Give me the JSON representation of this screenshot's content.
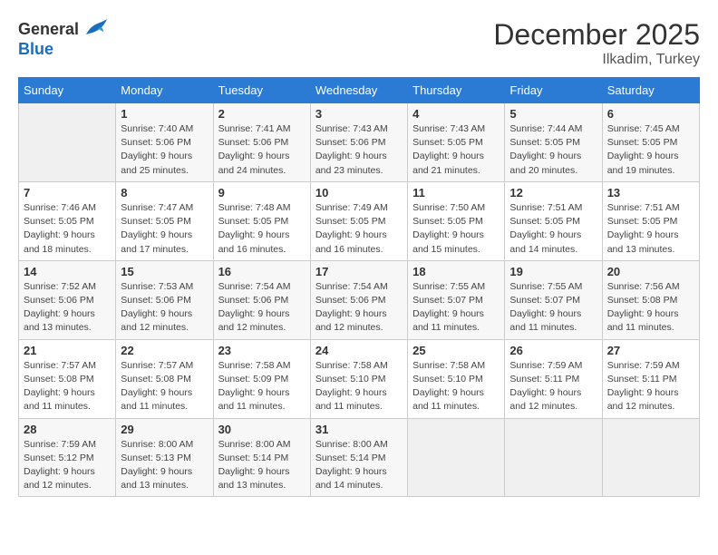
{
  "header": {
    "logo_general": "General",
    "logo_blue": "Blue",
    "month_year": "December 2025",
    "location": "Ilkadim, Turkey"
  },
  "days_of_week": [
    "Sunday",
    "Monday",
    "Tuesday",
    "Wednesday",
    "Thursday",
    "Friday",
    "Saturday"
  ],
  "weeks": [
    [
      {
        "day": "",
        "info": ""
      },
      {
        "day": "1",
        "info": "Sunrise: 7:40 AM\nSunset: 5:06 PM\nDaylight: 9 hours\nand 25 minutes."
      },
      {
        "day": "2",
        "info": "Sunrise: 7:41 AM\nSunset: 5:06 PM\nDaylight: 9 hours\nand 24 minutes."
      },
      {
        "day": "3",
        "info": "Sunrise: 7:43 AM\nSunset: 5:06 PM\nDaylight: 9 hours\nand 23 minutes."
      },
      {
        "day": "4",
        "info": "Sunrise: 7:43 AM\nSunset: 5:05 PM\nDaylight: 9 hours\nand 21 minutes."
      },
      {
        "day": "5",
        "info": "Sunrise: 7:44 AM\nSunset: 5:05 PM\nDaylight: 9 hours\nand 20 minutes."
      },
      {
        "day": "6",
        "info": "Sunrise: 7:45 AM\nSunset: 5:05 PM\nDaylight: 9 hours\nand 19 minutes."
      }
    ],
    [
      {
        "day": "7",
        "info": "Sunrise: 7:46 AM\nSunset: 5:05 PM\nDaylight: 9 hours\nand 18 minutes."
      },
      {
        "day": "8",
        "info": "Sunrise: 7:47 AM\nSunset: 5:05 PM\nDaylight: 9 hours\nand 17 minutes."
      },
      {
        "day": "9",
        "info": "Sunrise: 7:48 AM\nSunset: 5:05 PM\nDaylight: 9 hours\nand 16 minutes."
      },
      {
        "day": "10",
        "info": "Sunrise: 7:49 AM\nSunset: 5:05 PM\nDaylight: 9 hours\nand 16 minutes."
      },
      {
        "day": "11",
        "info": "Sunrise: 7:50 AM\nSunset: 5:05 PM\nDaylight: 9 hours\nand 15 minutes."
      },
      {
        "day": "12",
        "info": "Sunrise: 7:51 AM\nSunset: 5:05 PM\nDaylight: 9 hours\nand 14 minutes."
      },
      {
        "day": "13",
        "info": "Sunrise: 7:51 AM\nSunset: 5:05 PM\nDaylight: 9 hours\nand 13 minutes."
      }
    ],
    [
      {
        "day": "14",
        "info": "Sunrise: 7:52 AM\nSunset: 5:06 PM\nDaylight: 9 hours\nand 13 minutes."
      },
      {
        "day": "15",
        "info": "Sunrise: 7:53 AM\nSunset: 5:06 PM\nDaylight: 9 hours\nand 12 minutes."
      },
      {
        "day": "16",
        "info": "Sunrise: 7:54 AM\nSunset: 5:06 PM\nDaylight: 9 hours\nand 12 minutes."
      },
      {
        "day": "17",
        "info": "Sunrise: 7:54 AM\nSunset: 5:06 PM\nDaylight: 9 hours\nand 12 minutes."
      },
      {
        "day": "18",
        "info": "Sunrise: 7:55 AM\nSunset: 5:07 PM\nDaylight: 9 hours\nand 11 minutes."
      },
      {
        "day": "19",
        "info": "Sunrise: 7:55 AM\nSunset: 5:07 PM\nDaylight: 9 hours\nand 11 minutes."
      },
      {
        "day": "20",
        "info": "Sunrise: 7:56 AM\nSunset: 5:08 PM\nDaylight: 9 hours\nand 11 minutes."
      }
    ],
    [
      {
        "day": "21",
        "info": "Sunrise: 7:57 AM\nSunset: 5:08 PM\nDaylight: 9 hours\nand 11 minutes."
      },
      {
        "day": "22",
        "info": "Sunrise: 7:57 AM\nSunset: 5:08 PM\nDaylight: 9 hours\nand 11 minutes."
      },
      {
        "day": "23",
        "info": "Sunrise: 7:58 AM\nSunset: 5:09 PM\nDaylight: 9 hours\nand 11 minutes."
      },
      {
        "day": "24",
        "info": "Sunrise: 7:58 AM\nSunset: 5:10 PM\nDaylight: 9 hours\nand 11 minutes."
      },
      {
        "day": "25",
        "info": "Sunrise: 7:58 AM\nSunset: 5:10 PM\nDaylight: 9 hours\nand 11 minutes."
      },
      {
        "day": "26",
        "info": "Sunrise: 7:59 AM\nSunset: 5:11 PM\nDaylight: 9 hours\nand 12 minutes."
      },
      {
        "day": "27",
        "info": "Sunrise: 7:59 AM\nSunset: 5:11 PM\nDaylight: 9 hours\nand 12 minutes."
      }
    ],
    [
      {
        "day": "28",
        "info": "Sunrise: 7:59 AM\nSunset: 5:12 PM\nDaylight: 9 hours\nand 12 minutes."
      },
      {
        "day": "29",
        "info": "Sunrise: 8:00 AM\nSunset: 5:13 PM\nDaylight: 9 hours\nand 13 minutes."
      },
      {
        "day": "30",
        "info": "Sunrise: 8:00 AM\nSunset: 5:14 PM\nDaylight: 9 hours\nand 13 minutes."
      },
      {
        "day": "31",
        "info": "Sunrise: 8:00 AM\nSunset: 5:14 PM\nDaylight: 9 hours\nand 14 minutes."
      },
      {
        "day": "",
        "info": ""
      },
      {
        "day": "",
        "info": ""
      },
      {
        "day": "",
        "info": ""
      }
    ]
  ]
}
